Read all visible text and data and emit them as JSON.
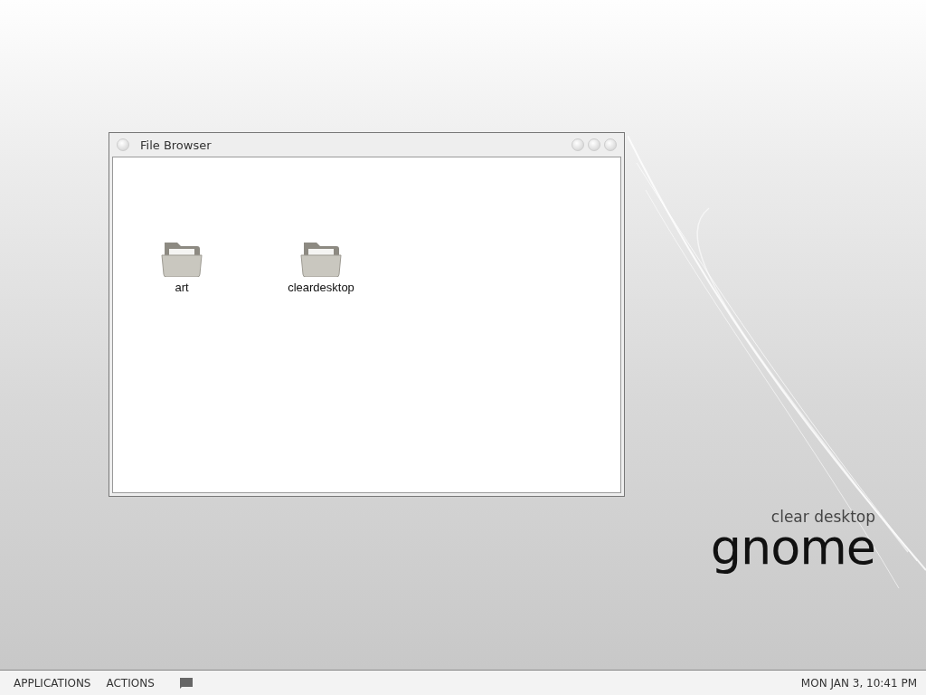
{
  "window": {
    "title": "File Browser",
    "items": [
      {
        "name": "art"
      },
      {
        "name": "cleardesktop"
      }
    ]
  },
  "wallpaper": {
    "tagline": "clear desktop",
    "logo": "gnome"
  },
  "panel": {
    "menus": [
      "APPLICATIONS",
      "ACTIONS"
    ],
    "clock": "MON JAN 3, 10:41 PM"
  }
}
